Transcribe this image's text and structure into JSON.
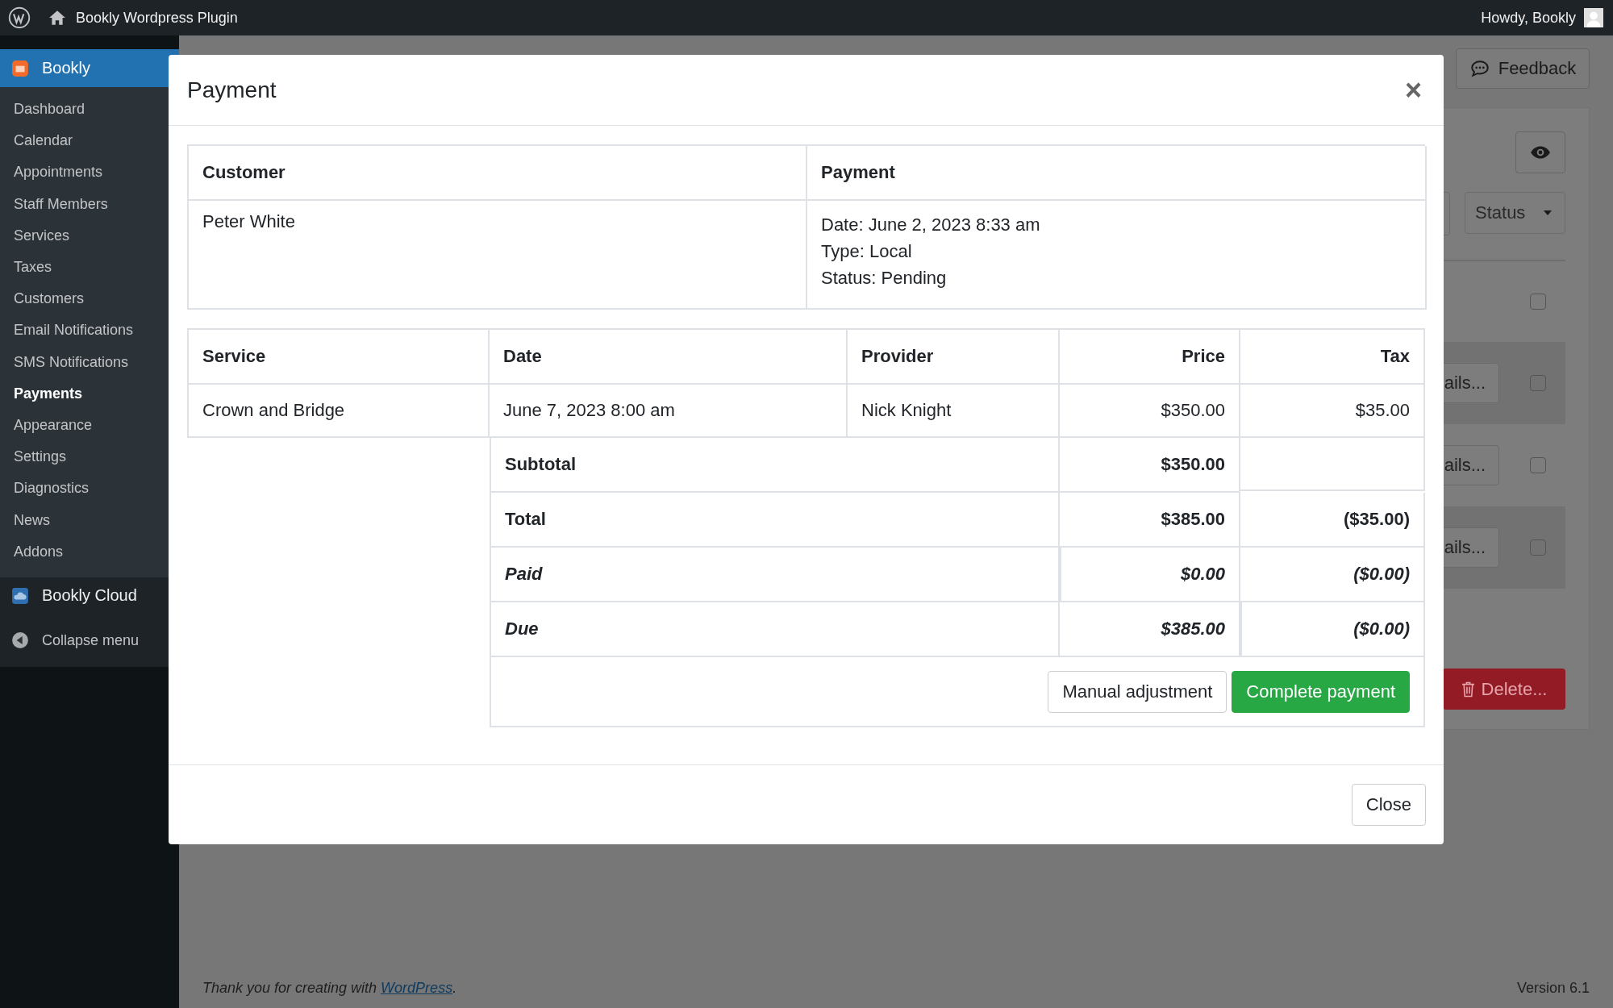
{
  "admin_bar": {
    "site_name": "Bookly Wordpress Plugin",
    "greeting": "Howdy, Bookly"
  },
  "sidebar": {
    "plugin": "Bookly",
    "items": [
      {
        "label": "Dashboard",
        "selected": false
      },
      {
        "label": "Calendar",
        "selected": false
      },
      {
        "label": "Appointments",
        "selected": false
      },
      {
        "label": "Staff Members",
        "selected": false
      },
      {
        "label": "Services",
        "selected": false
      },
      {
        "label": "Taxes",
        "selected": false
      },
      {
        "label": "Customers",
        "selected": false
      },
      {
        "label": "Email Notifications",
        "selected": false
      },
      {
        "label": "SMS Notifications",
        "selected": false
      },
      {
        "label": "Payments",
        "selected": true
      },
      {
        "label": "Appearance",
        "selected": false
      },
      {
        "label": "Settings",
        "selected": false
      },
      {
        "label": "Diagnostics",
        "selected": false
      },
      {
        "label": "News",
        "selected": false
      },
      {
        "label": "Addons",
        "selected": false
      }
    ],
    "cloud": "Bookly Cloud",
    "collapse": "Collapse menu"
  },
  "background": {
    "feedback": "Feedback",
    "status_filter": "Status",
    "header_checkbox": {
      "checked": false
    },
    "rows": [
      {
        "details": "ails...",
        "checked": false
      },
      {
        "details": "ails...",
        "checked": false
      },
      {
        "details": "ails...",
        "checked": false
      }
    ],
    "delete": "Delete..."
  },
  "modal": {
    "title": "Payment",
    "close_symbol": "×",
    "info_table": {
      "columns": [
        "Customer",
        "Payment"
      ],
      "customer": "Peter White",
      "payment_lines": [
        "Date: June 2, 2023 8:33 am",
        "Type: Local",
        "Status: Pending"
      ]
    },
    "items_table": {
      "columns": [
        "Service",
        "Date",
        "Provider",
        "Price",
        "Tax"
      ],
      "rows": [
        {
          "service": "Crown and Bridge",
          "date": "June 7, 2023 8:00 am",
          "provider": "Nick Knight",
          "price": "$350.00",
          "tax": "$35.00"
        }
      ],
      "summary": [
        {
          "label": "Subtotal",
          "italic": false,
          "price": "$350.00"
        },
        {
          "label": "Total",
          "italic": false,
          "price": "$385.00",
          "tax": "($35.00)"
        },
        {
          "label": "Paid",
          "italic": true,
          "price": "$0.00",
          "tax": "($0.00)"
        },
        {
          "label": "Due",
          "italic": true,
          "price": "$385.00",
          "tax": "($0.00)"
        }
      ]
    },
    "actions": [
      "Manual adjustment",
      "Complete payment"
    ],
    "close_button": "Close"
  },
  "footer": {
    "credit_prefix": "Thank you for creating with ",
    "credit_link": "WordPress",
    "credit_suffix": ".",
    "version": "Version 6.1"
  }
}
